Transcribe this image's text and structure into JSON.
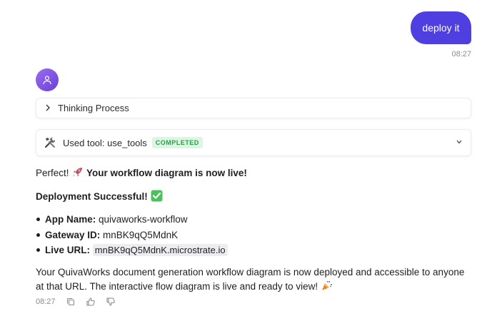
{
  "user_message": {
    "text": "deploy it",
    "time": "08:27"
  },
  "thinking": {
    "label": "Thinking Process"
  },
  "tool_call": {
    "label": "Used tool: use_tools",
    "status": "COMPLETED"
  },
  "response": {
    "intro_prefix": "Perfect! ",
    "intro_bold": "Your workflow diagram is now live!",
    "heading": "Deployment Successful! ",
    "details": [
      {
        "label": "App Name:",
        "value": " quivaworks-workflow"
      },
      {
        "label": "Gateway ID:",
        "value": " mnBK9qQ5MdnK"
      },
      {
        "label": "Live URL:",
        "value": "mnBK9qQ5MdnK.microstrate.io"
      }
    ],
    "paragraph": "Your QuivaWorks document generation workflow diagram is now deployed and accessible to anyone at that URL. The interactive flow diagram is live and ready to view! ",
    "time": "08:27"
  },
  "icons": {
    "avatar": "user-icon",
    "thinking_toggle": "chevron-right-icon",
    "tool": "tools-icon",
    "tool_toggle": "chevron-down-icon",
    "copy": "copy-icon",
    "like": "thumbs-up-icon",
    "dislike": "thumbs-down-icon"
  },
  "colors": {
    "accent": "#4f3fe0",
    "avatar": "#8b5cf6",
    "success_bg": "#ddf6e4",
    "success_text": "#26a046"
  }
}
